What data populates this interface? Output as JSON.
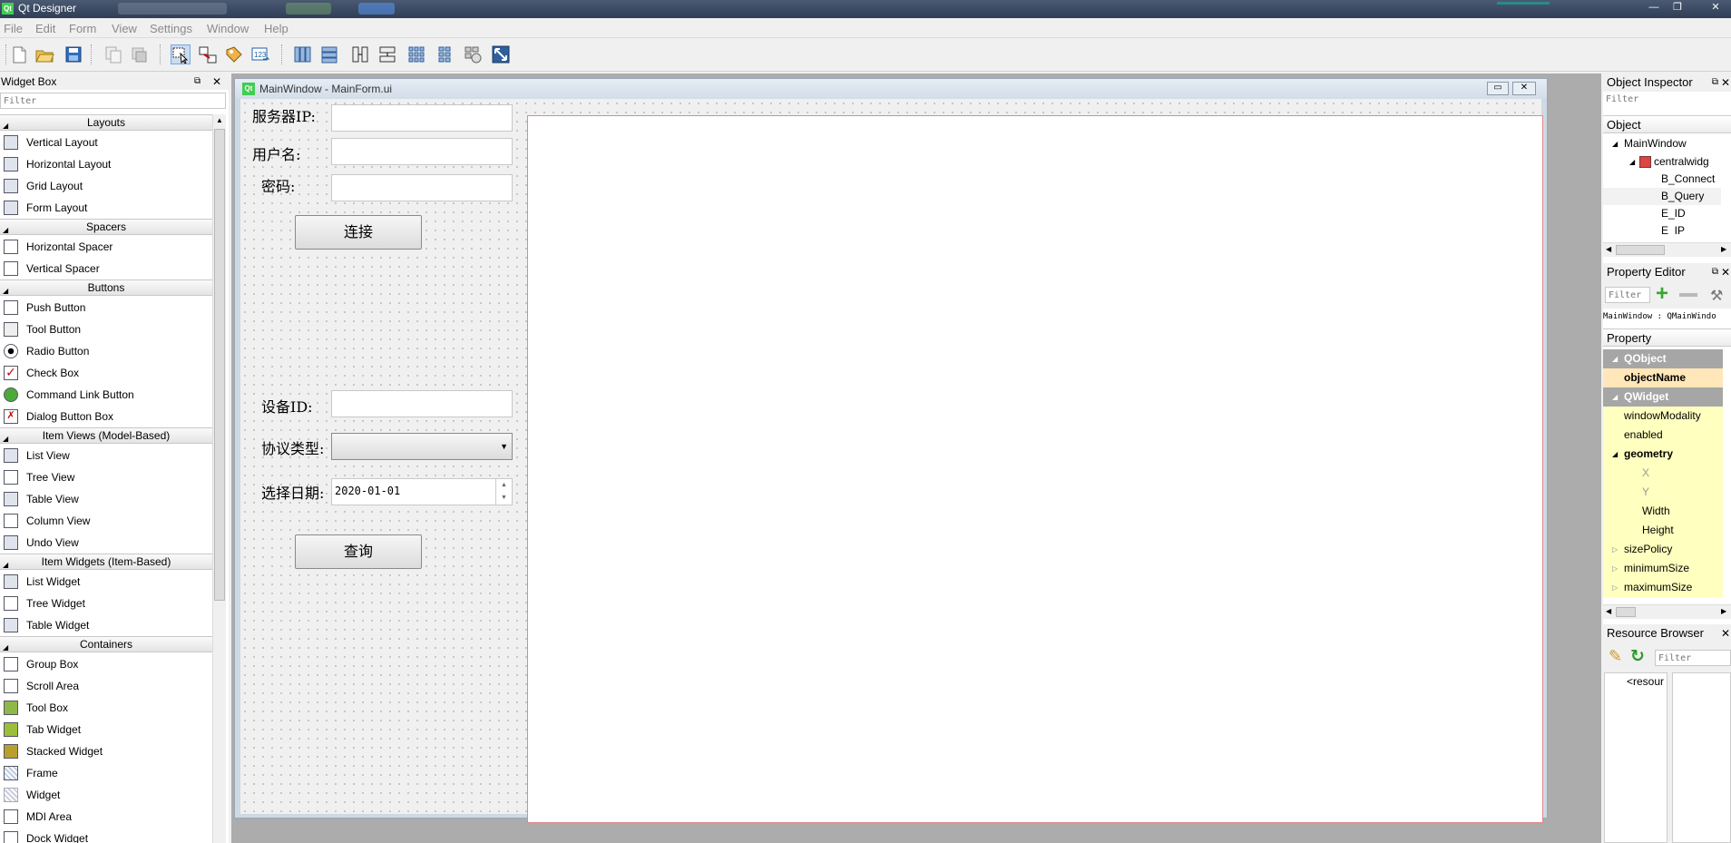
{
  "app": {
    "title": "Qt Designer",
    "logo": "Qt"
  },
  "menu": [
    "File",
    "Edit",
    "Form",
    "View",
    "Settings",
    "Window",
    "Help"
  ],
  "window_controls": {
    "minimize": "—",
    "restore": "❐",
    "close": "✕"
  },
  "widget_box": {
    "title": "Widget Box",
    "filter_placeholder": "Filter",
    "categories": [
      {
        "name": "Layouts",
        "items": [
          "Vertical Layout",
          "Horizontal Layout",
          "Grid Layout",
          "Form Layout"
        ]
      },
      {
        "name": "Spacers",
        "items": [
          "Horizontal Spacer",
          "Vertical Spacer"
        ]
      },
      {
        "name": "Buttons",
        "items": [
          "Push Button",
          "Tool Button",
          "Radio Button",
          "Check Box",
          "Command Link Button",
          "Dialog Button Box"
        ]
      },
      {
        "name": "Item Views (Model-Based)",
        "items": [
          "List View",
          "Tree View",
          "Table View",
          "Column View",
          "Undo View"
        ]
      },
      {
        "name": "Item Widgets (Item-Based)",
        "items": [
          "List Widget",
          "Tree Widget",
          "Table Widget"
        ]
      },
      {
        "name": "Containers",
        "items": [
          "Group Box",
          "Scroll Area",
          "Tool Box",
          "Tab Widget",
          "Stacked Widget",
          "Frame",
          "Widget",
          "MDI Area",
          "Dock Widget"
        ]
      }
    ]
  },
  "form_window": {
    "title": "MainWindow - MainForm.ui",
    "logo": "Qt",
    "fields": {
      "server_ip_label": "服务器IP:",
      "username_label": "用户名:",
      "password_label": "密码:",
      "connect_button": "连接",
      "device_id_label": "设备ID:",
      "protocol_label": "协议类型:",
      "date_label": "选择日期:",
      "date_value": "2020-01-01",
      "query_button": "查询"
    }
  },
  "object_inspector": {
    "title": "Object Inspector",
    "filter_placeholder": "Filter",
    "header": "Object",
    "tree": [
      "MainWindow",
      "centralwidg",
      "B_Connect",
      "B_Query",
      "E_ID",
      "E_IP"
    ]
  },
  "property_editor": {
    "title": "Property Editor",
    "filter_placeholder": "Filter",
    "context": "MainWindow : QMainWindo",
    "header": "Property",
    "rows": [
      {
        "label": "QObject",
        "kind": "group"
      },
      {
        "label": "objectName",
        "kind": "bold"
      },
      {
        "label": "QWidget",
        "kind": "group"
      },
      {
        "label": "windowModality",
        "kind": "prop"
      },
      {
        "label": "enabled",
        "kind": "prop"
      },
      {
        "label": "geometry",
        "kind": "bold"
      },
      {
        "label": "X",
        "kind": "sub-dim"
      },
      {
        "label": "Y",
        "kind": "sub-dim"
      },
      {
        "label": "Width",
        "kind": "sub"
      },
      {
        "label": "Height",
        "kind": "sub"
      },
      {
        "label": "sizePolicy",
        "kind": "prop"
      },
      {
        "label": "minimumSize",
        "kind": "prop"
      },
      {
        "label": "maximumSize",
        "kind": "prop"
      }
    ]
  },
  "resource_browser": {
    "title": "Resource Browser",
    "filter_placeholder": "Filter",
    "root": "<resour"
  },
  "colors": {
    "accent": "#41cd52",
    "prop_yellow": "#ffffbf",
    "prop_group": "#a6a6a6",
    "select_blue": "#c9dcf3"
  }
}
